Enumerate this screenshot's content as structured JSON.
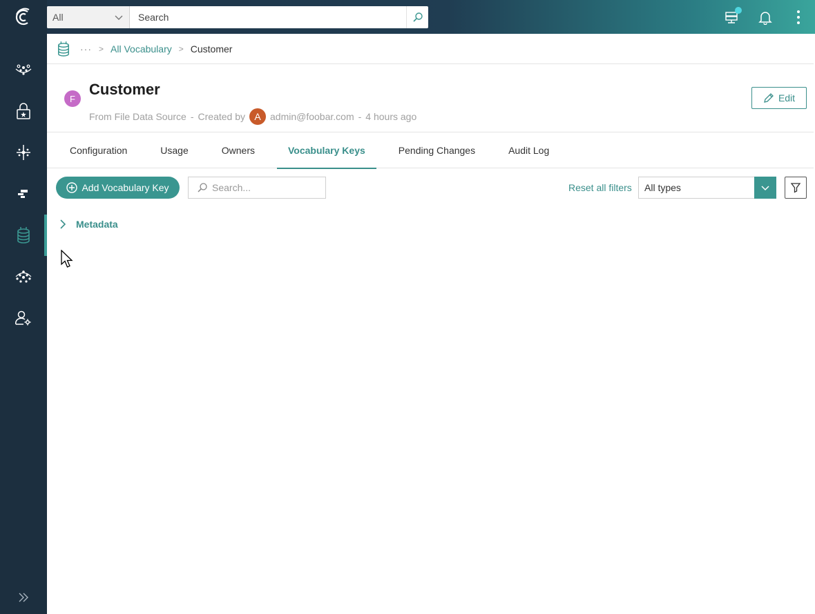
{
  "topbar": {
    "search_scope": "All",
    "search_placeholder": "Search"
  },
  "icons": {
    "logo": "cluedin-logo-icon",
    "search": "search-icon",
    "environment": "server-status-icon",
    "notifications": "bell-icon",
    "more": "vertical-dots-icon"
  },
  "sidebar": {
    "items": [
      {
        "icon": "integration-icon"
      },
      {
        "icon": "governance-lock-icon"
      },
      {
        "icon": "preparation-icon"
      },
      {
        "icon": "management-icon"
      },
      {
        "icon": "vocabulary-database-icon",
        "active": true
      },
      {
        "icon": "consume-icon"
      },
      {
        "icon": "admin-user-settings-icon"
      }
    ],
    "expand_icon": "double-chevron-right-icon"
  },
  "breadcrumb": {
    "more": "···",
    "parent": "All Vocabulary",
    "current": "Customer"
  },
  "entity": {
    "avatar_letter": "F",
    "title": "Customer",
    "from_label": "From",
    "source": "File Data Source",
    "created_by_label": "Created by",
    "user_avatar_letter": "A",
    "user": "admin@foobar.com",
    "time": "4 hours ago",
    "edit_label": "Edit"
  },
  "tabs": [
    {
      "label": "Configuration"
    },
    {
      "label": "Usage"
    },
    {
      "label": "Owners"
    },
    {
      "label": "Vocabulary Keys",
      "active": true
    },
    {
      "label": "Pending Changes"
    },
    {
      "label": "Audit Log"
    }
  ],
  "toolbar": {
    "add_label": "Add Vocabulary Key",
    "search_placeholder": "Search...",
    "reset_label": "Reset all filters",
    "type_value": "All types"
  },
  "groups": [
    {
      "label": "Metadata"
    }
  ],
  "colors": {
    "accent": "#3a8f8b",
    "sidebar": "#1c2f3f",
    "entity_avatar": "#c56bc7",
    "user_avatar": "#c85a2a"
  }
}
